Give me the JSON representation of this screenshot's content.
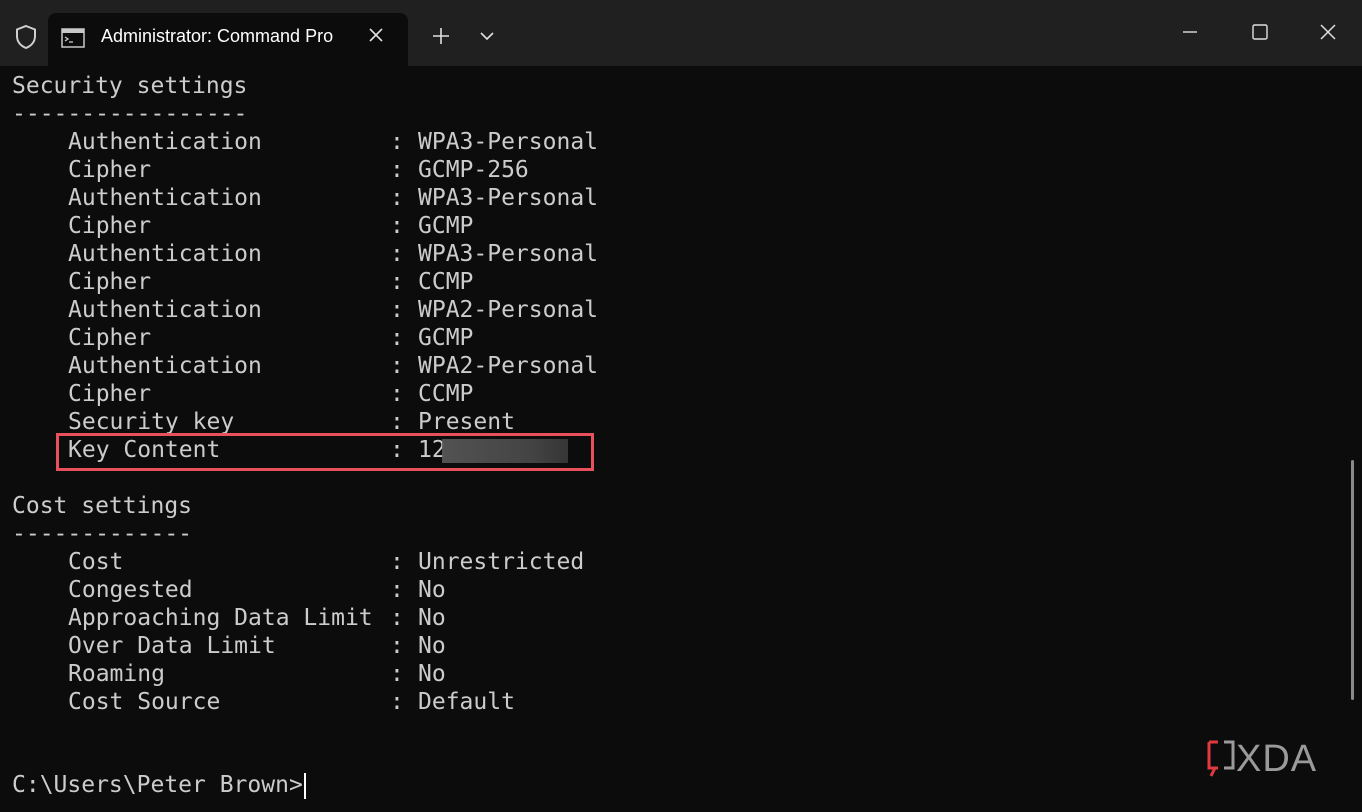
{
  "window": {
    "tab_title": "Administrator: Command Pro",
    "icons": [
      "shield-icon",
      "cmd-icon",
      "close-icon",
      "plus-icon",
      "chevron-down-icon",
      "minimize-icon",
      "maximize-icon",
      "close-icon"
    ]
  },
  "terminal": {
    "security_heading": "Security settings",
    "security_rule": "-----------------",
    "security_rows": [
      {
        "key": "Authentication",
        "value": "WPA3-Personal"
      },
      {
        "key": "Cipher",
        "value": "GCMP-256"
      },
      {
        "key": "Authentication",
        "value": "WPA3-Personal"
      },
      {
        "key": "Cipher",
        "value": "GCMP"
      },
      {
        "key": "Authentication",
        "value": "WPA3-Personal"
      },
      {
        "key": "Cipher",
        "value": "CCMP"
      },
      {
        "key": "Authentication",
        "value": "WPA2-Personal"
      },
      {
        "key": "Cipher",
        "value": "GCMP"
      },
      {
        "key": "Authentication",
        "value": "WPA2-Personal"
      },
      {
        "key": "Cipher",
        "value": "CCMP"
      },
      {
        "key": "Security key",
        "value": "Present"
      },
      {
        "key": "Key Content",
        "value": "12"
      }
    ],
    "separator": ":",
    "cost_heading": "Cost settings",
    "cost_rule": "-------------",
    "cost_rows": [
      {
        "key": "Cost",
        "value": "Unrestricted"
      },
      {
        "key": "Congested",
        "value": "No"
      },
      {
        "key": "Approaching Data Limit",
        "value": "No"
      },
      {
        "key": "Over Data Limit",
        "value": "No"
      },
      {
        "key": "Roaming",
        "value": "No"
      },
      {
        "key": "Cost Source",
        "value": "Default"
      }
    ],
    "prompt": "C:\\Users\\Peter Brown>"
  },
  "watermark": {
    "text": "XDA"
  },
  "colors": {
    "background": "#0c0c0c",
    "titlebar": "#202020",
    "text": "#cccccc",
    "highlight_border": "#e8505b",
    "watermark_accent": "#e03a3e"
  }
}
